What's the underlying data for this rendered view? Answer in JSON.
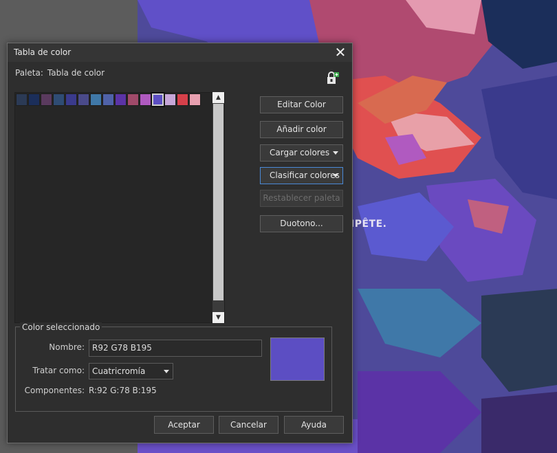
{
  "background": {
    "overlay_text": "IPÊTE."
  },
  "dialog": {
    "title": "Tabla de color",
    "palette_label": "Paleta:",
    "palette_value": "Tabla de color",
    "swatches": [
      {
        "color": "#2b3a55"
      },
      {
        "color": "#1b2e5a"
      },
      {
        "color": "#5a3a5e"
      },
      {
        "color": "#2f4c74"
      },
      {
        "color": "#3a3a8c"
      },
      {
        "color": "#4a4a8a"
      },
      {
        "color": "#3f78a8"
      },
      {
        "color": "#4f62a8"
      },
      {
        "color": "#5b33a6"
      },
      {
        "color": "#a04a6a"
      },
      {
        "color": "#b05ac0"
      },
      {
        "color": "#5c4ec3"
      },
      {
        "color": "#c6a6d8"
      },
      {
        "color": "#d6404a"
      },
      {
        "color": "#e8a0b0"
      }
    ],
    "selected_swatch_index": 11,
    "buttons": {
      "edit_color": "Editar Color",
      "add_color": "Añadir color",
      "load_colors": "Cargar colores",
      "sort_colors": "Clasificar colores",
      "reset_palette": "Restablecer paleta",
      "duotone": "Duotono..."
    },
    "selected_group": {
      "title": "Color seleccionado",
      "name_label": "Nombre:",
      "name_value": "R92 G78 B195",
      "treat_as_label": "Tratar como:",
      "treat_as_value": "Cuatricromía",
      "components_label": "Componentes:",
      "components_value": "R:92 G:78 B:195",
      "preview_color": "#5c4ec3"
    },
    "footer": {
      "ok": "Aceptar",
      "cancel": "Cancelar",
      "help": "Ayuda"
    }
  }
}
